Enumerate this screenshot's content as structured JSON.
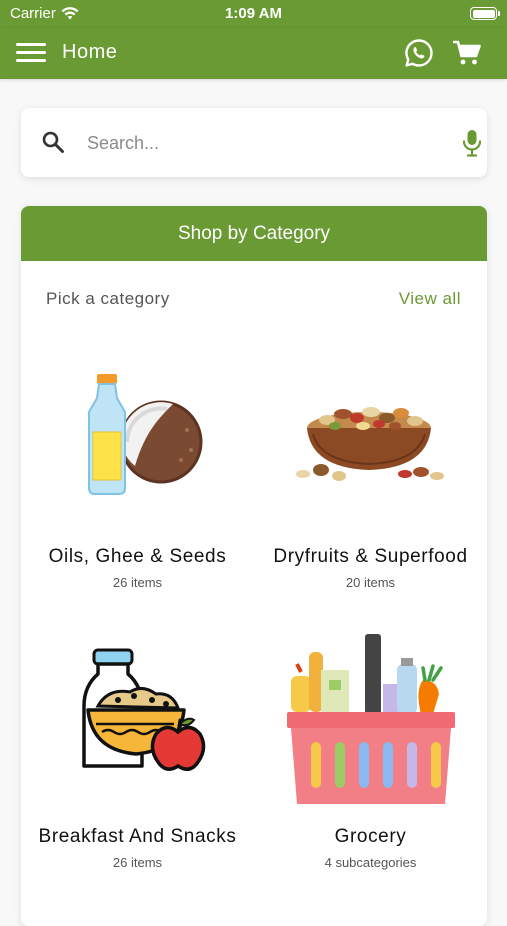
{
  "status_bar": {
    "carrier": "Carrier",
    "time": "1:09 AM"
  },
  "app_bar": {
    "title": "Home",
    "menu_icon": "hamburger-icon",
    "whatsapp_icon": "whatsapp-icon",
    "cart_icon": "cart-icon"
  },
  "search": {
    "placeholder": "Search...",
    "value": "",
    "search_icon": "magnifier-icon",
    "mic_icon": "microphone-icon"
  },
  "category_section": {
    "header": "Shop by Category",
    "pick_label": "Pick a category",
    "view_all": "View all",
    "items": [
      {
        "name": "Oils, Ghee & Seeds",
        "count": "26 items",
        "icon": "oil-bottle-coconut-icon"
      },
      {
        "name": "Dryfruits & Superfood",
        "count": "20 items",
        "icon": "dryfruit-bowl-icon"
      },
      {
        "name": "Breakfast And Snacks",
        "count": "26 items",
        "icon": "breakfast-bowl-milk-apple-icon"
      },
      {
        "name": "Grocery",
        "count": "4 subcategories",
        "icon": "grocery-basket-icon"
      }
    ]
  },
  "colors": {
    "primary": "#6a9a34",
    "background": "#f8f8f8",
    "card": "#ffffff"
  }
}
